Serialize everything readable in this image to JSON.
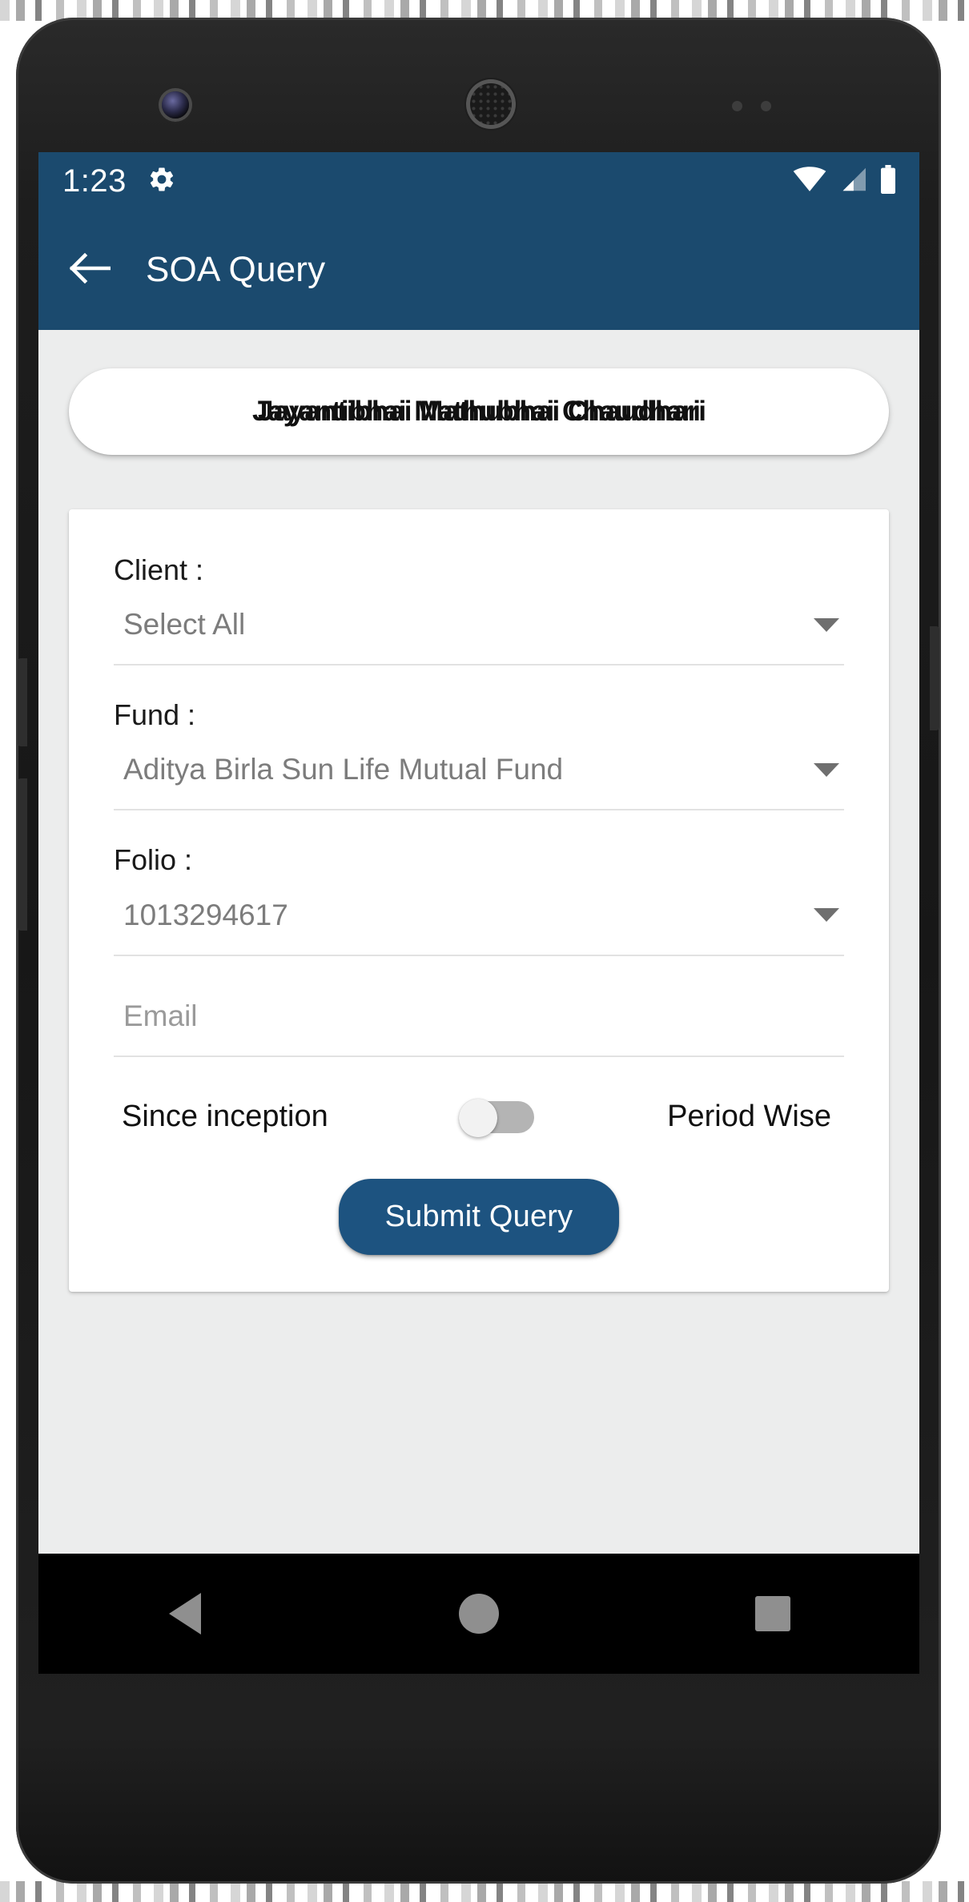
{
  "status_bar": {
    "time": "1:23",
    "gear_icon": "gear-icon",
    "wifi_icon": "wifi-icon",
    "signal_icon": "cell-signal-icon",
    "battery_icon": "battery-full-icon"
  },
  "app_bar": {
    "back_icon": "back-arrow-icon",
    "title": "SOA Query"
  },
  "client_name_card": {
    "name": "Jayantibhai Mathubhai Chaudhari",
    "name_overlay": "Jayantibhai Mathubhai Chaudhari"
  },
  "form": {
    "client": {
      "label": "Client :",
      "value": "Select All",
      "caret_icon": "chevron-down-icon"
    },
    "fund": {
      "label": "Fund :",
      "value": "Aditya Birla Sun Life Mutual Fund",
      "caret_icon": "chevron-down-icon"
    },
    "folio": {
      "label": "Folio :",
      "value": "1013294617",
      "caret_icon": "chevron-down-icon"
    },
    "email": {
      "placeholder": "Email",
      "value": ""
    },
    "period_toggle": {
      "left_label": "Since inception",
      "right_label": "Period Wise",
      "state": "off"
    },
    "submit_label": "Submit Query"
  },
  "nav_bar": {
    "back_icon": "nav-back-triangle-icon",
    "home_icon": "nav-home-circle-icon",
    "recents_icon": "nav-recents-square-icon"
  },
  "colors": {
    "app_bar": "#1b4a6e",
    "status_bar": "#1b4a6e",
    "submit_button": "#1d5380",
    "screen_bg": "#eceded",
    "card_bg": "#ffffff"
  }
}
